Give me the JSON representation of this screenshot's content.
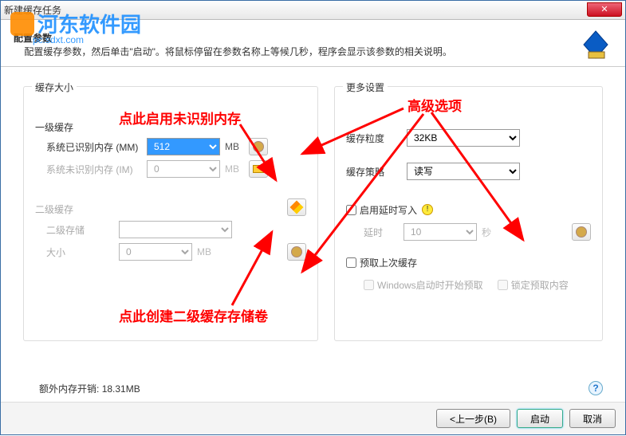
{
  "window": {
    "title": "新建缓存任务"
  },
  "watermark": {
    "text": "河东软件园",
    "sub": "pc.sdxt.com"
  },
  "header": {
    "title": "配置参数",
    "desc": "配置缓存参数，然后单击\"启动\"。将鼠标停留在参数名称上等候几秒，程序会显示该参数的相关说明。"
  },
  "left": {
    "group_label": "缓存大小",
    "l1_label": "一级缓存",
    "mm_label": "系统已识别内存 (MM)",
    "mm_value": "512",
    "mm_unit": "MB",
    "im_label": "系统未识别内存 (IM)",
    "im_value": "0",
    "im_unit": "MB",
    "l2_label": "二级缓存",
    "storage_label": "二级存储",
    "size_label": "大小",
    "size_value": "0",
    "size_unit": "MB"
  },
  "right": {
    "group_label": "更多设置",
    "granularity_label": "缓存粒度",
    "granularity_value": "32KB",
    "strategy_label": "缓存策略",
    "strategy_value": "读写",
    "defer_write": "启用延时写入",
    "delay_label": "延时",
    "delay_value": "10",
    "delay_unit": "秒",
    "prefetch_last": "预取上次缓存",
    "prefetch_boot": "Windows启动时开始预取",
    "lock_prefetch": "锁定预取内容"
  },
  "footer": {
    "overhead_label": "额外内存开销:",
    "overhead_value": "18.31MB"
  },
  "buttons": {
    "back": "<上一步(B)",
    "start": "启动",
    "cancel": "取消"
  },
  "annotations": {
    "a1": "点此启用未识别内存",
    "a2": "高级选项",
    "a3": "点此创建二级缓存存储卷"
  }
}
